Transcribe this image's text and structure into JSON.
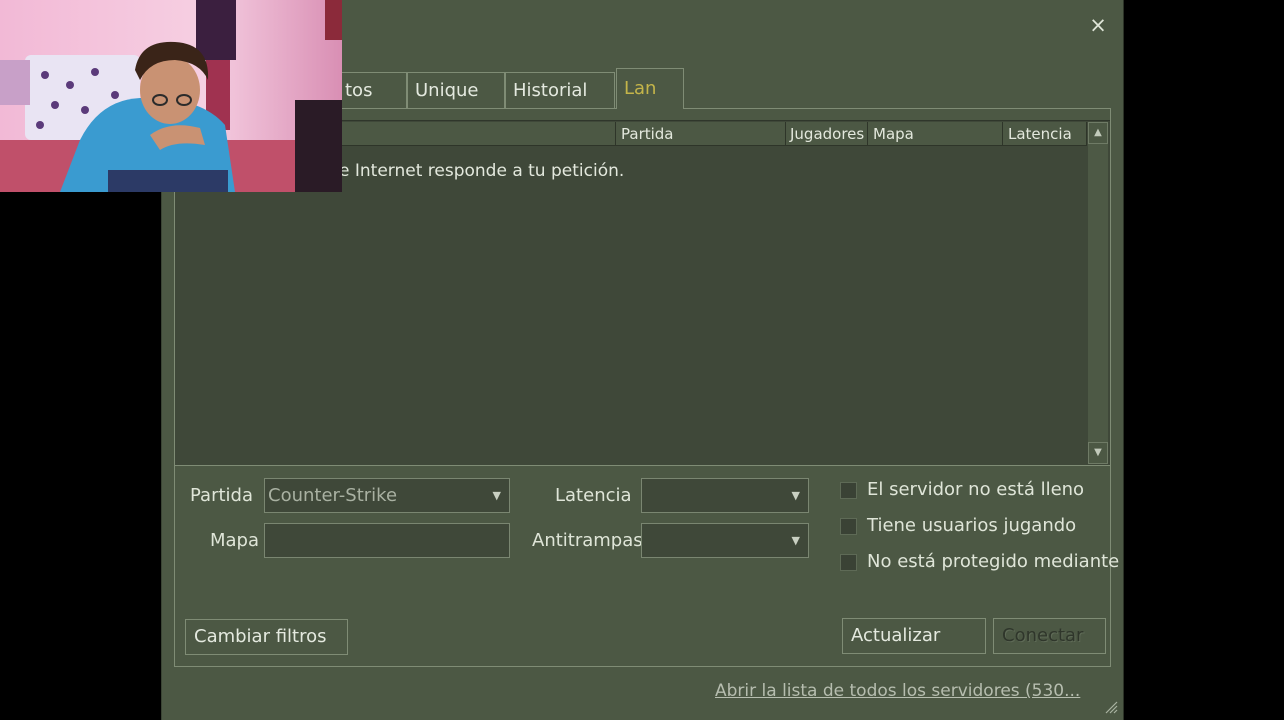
{
  "window": {
    "close_glyph": "×"
  },
  "tabs": [
    {
      "label": "tos"
    },
    {
      "label": "Unique"
    },
    {
      "label": "Historial"
    },
    {
      "label": "Lan",
      "active": true
    }
  ],
  "columns": [
    {
      "label": "Partida"
    },
    {
      "label": "Jugadores"
    },
    {
      "label": "Mapa"
    },
    {
      "label": "Latencia"
    }
  ],
  "list_message": "e Internet responde a tu petición.",
  "filters": {
    "partida_label": "Partida",
    "partida_value": "Counter-Strike",
    "mapa_label": "Mapa",
    "mapa_value": "",
    "latencia_label": "Latencia",
    "latencia_value": "",
    "antitrampas_label": "Antitrampas",
    "antitrampas_value": ""
  },
  "checkboxes": [
    {
      "label": "El servidor no está lleno",
      "checked": false
    },
    {
      "label": "Tiene usuarios jugando",
      "checked": false
    },
    {
      "label": "No está protegido mediante",
      "checked": false
    }
  ],
  "buttons": {
    "change_filters": "Cambiar filtros",
    "refresh": "Actualizar",
    "connect": "Conectar"
  },
  "footer_link": "Abrir la lista de todos los servidores (530...",
  "icons": {
    "close": "close-icon",
    "scroll_up": "scroll-up-icon",
    "scroll_down": "scroll-down-icon",
    "dropdown": "chevron-down-icon",
    "resize": "resize-grip-icon"
  },
  "colors": {
    "window_bg": "#4c5844",
    "list_bg": "#3f4839",
    "active_tab_text": "#c4b54a",
    "border": "#7f8c75"
  }
}
